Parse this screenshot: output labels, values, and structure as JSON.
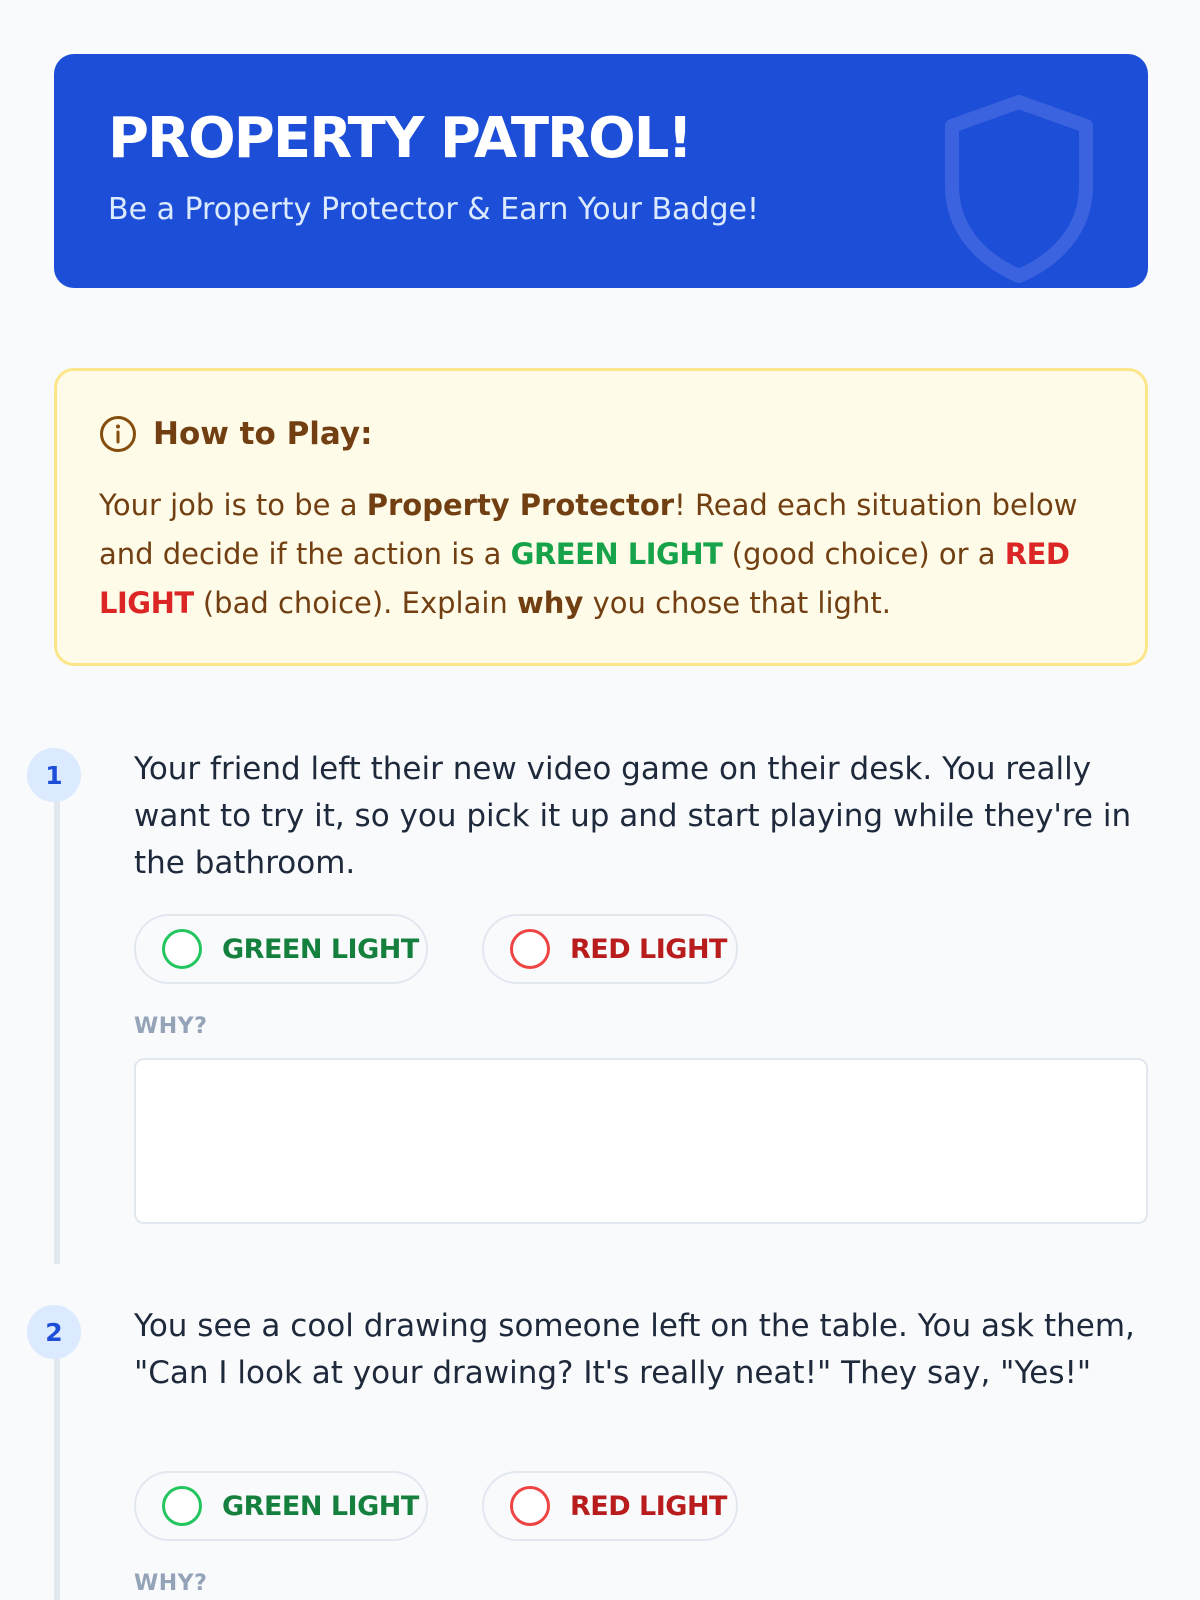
{
  "header": {
    "title": "PROPERTY PATROL!",
    "subtitle": "Be a Property Protector & Earn Your Badge!"
  },
  "instructions": {
    "title": "How to Play:",
    "text_parts": {
      "p1": "Your job is to be a ",
      "b1": "Property Protector",
      "p2": "! Read each situation below and decide if the action is a ",
      "green": "GREEN LIGHT",
      "p3": " (good choice) or a ",
      "red": "RED LIGHT",
      "p4": " (bad choice). Explain ",
      "b2": "why",
      "p5": " you chose that light."
    }
  },
  "questions": [
    {
      "number": "1",
      "text": "Your friend left their new video game on their desk. You really want to try it, so you pick it up and start playing while they're in the bathroom.",
      "green_label": "GREEN LIGHT",
      "red_label": "RED LIGHT",
      "why_label": "WHY?",
      "answer": ""
    },
    {
      "number": "2",
      "text": "You see a cool drawing someone left on the table. You ask them, \"Can I look at your drawing? It's really neat!\" They say, \"Yes!\"",
      "green_label": "GREEN LIGHT",
      "red_label": "RED LIGHT",
      "why_label": "WHY?",
      "answer": ""
    }
  ],
  "icons": {
    "header": "shield-icon",
    "instructions": "info-icon",
    "choice": "radio-ring-icon"
  },
  "colors": {
    "brand_blue": "#1d4ed8",
    "green": "#16a34a",
    "red": "#dc2626",
    "note_bg": "#fefce8"
  }
}
